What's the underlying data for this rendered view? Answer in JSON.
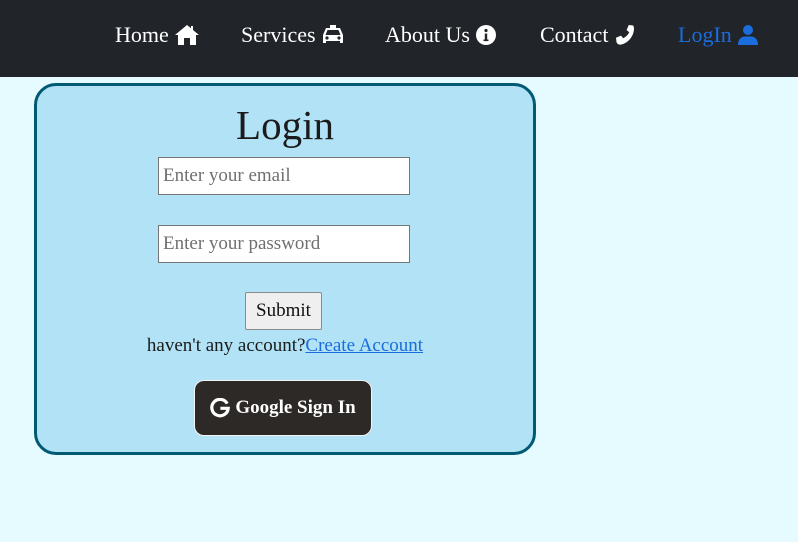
{
  "nav": {
    "items": [
      {
        "label": "Home",
        "icon": "home-icon"
      },
      {
        "label": "Services",
        "icon": "taxi-icon"
      },
      {
        "label": "About Us",
        "icon": "info-icon"
      },
      {
        "label": "Contact",
        "icon": "phone-icon"
      },
      {
        "label": "LogIn",
        "icon": "user-icon",
        "active": true
      }
    ]
  },
  "login": {
    "title": "Login",
    "email_placeholder": "Enter your email",
    "password_placeholder": "Enter your password",
    "submit_label": "Submit",
    "no_account_text": "haven't any account?",
    "create_account_link": "Create Account",
    "google_label": "Google Sign In",
    "google_icon": "google-icon"
  },
  "colors": {
    "page_bg": "#e6fbff",
    "navbar_bg": "#212429",
    "card_bg": "#b1e2f5",
    "card_border": "#005a73",
    "link": "#1a6ddd",
    "google_button_bg": "#2d2927"
  }
}
